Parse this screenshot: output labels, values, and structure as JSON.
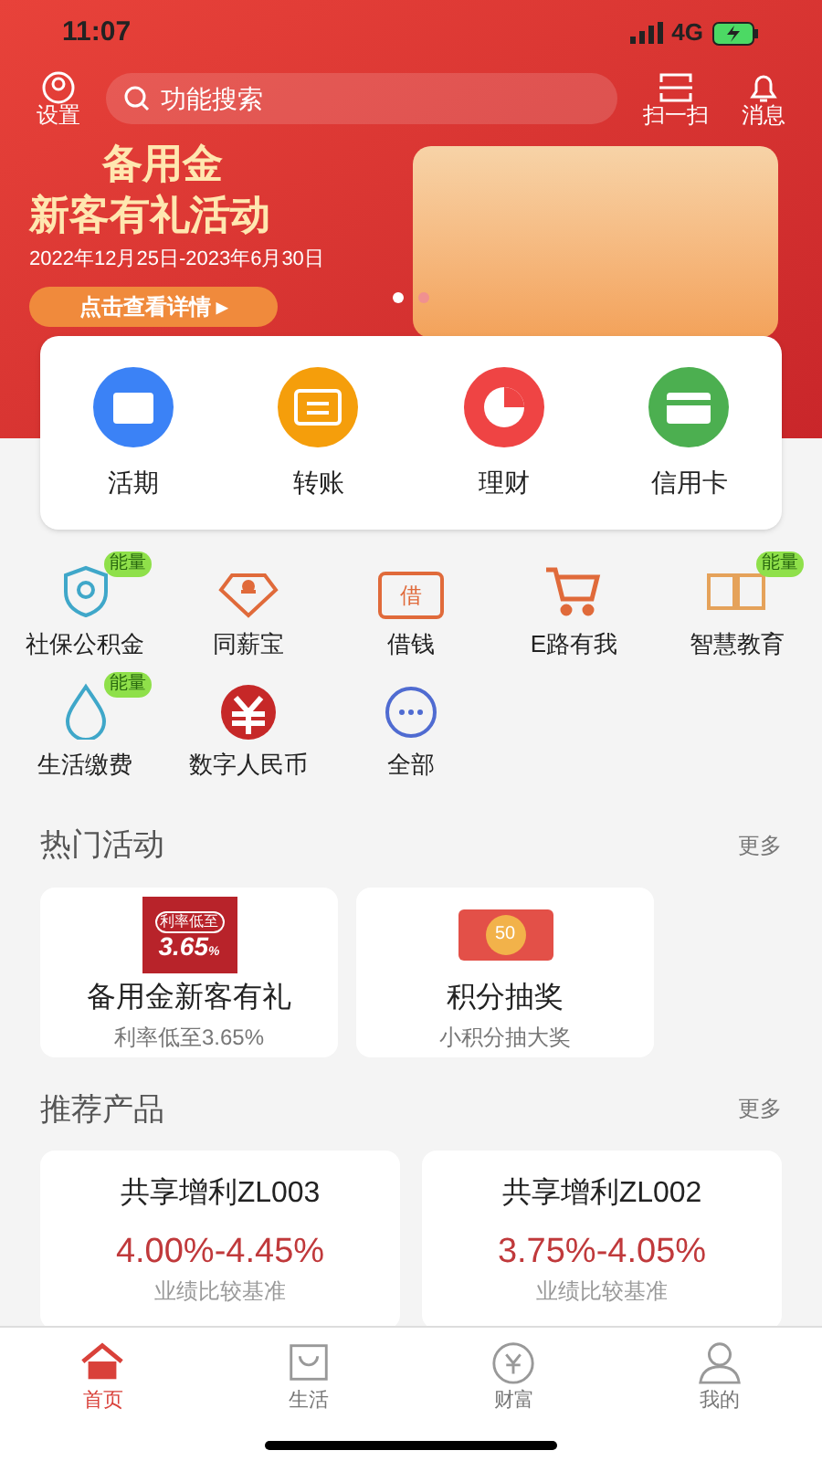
{
  "status_bar": {
    "time": "11:07",
    "network": "4G"
  },
  "header": {
    "settings_label": "设置",
    "search_placeholder": "功能搜索",
    "scan_label": "扫一扫",
    "messages_label": "消息"
  },
  "banner": {
    "title": "备用金",
    "subtitle": "新客有礼活动",
    "dates": "2022年12月25日-2023年6月30日",
    "button": "点击查看详情 ▸",
    "dots": [
      {
        "selected": true
      },
      {
        "selected": false
      }
    ]
  },
  "quick_actions": [
    {
      "label": "活期",
      "kind": "folder",
      "color": "#3b82f6"
    },
    {
      "label": "转账",
      "kind": "transfer",
      "color": "#f59e0b"
    },
    {
      "label": "理财",
      "kind": "pie",
      "color": "#ef4444"
    },
    {
      "label": "信用卡",
      "kind": "card",
      "color": "#4caf50"
    }
  ],
  "services": [
    {
      "label": "社保公积金",
      "kind": "shield",
      "badge": "能量"
    },
    {
      "label": "同薪宝",
      "kind": "diamond"
    },
    {
      "label": "借钱",
      "kind": "borrow",
      "icon_text": "借"
    },
    {
      "label": "E路有我",
      "kind": "cart"
    },
    {
      "label": "智慧教育",
      "kind": "book",
      "badge": "能量"
    },
    {
      "label": "生活缴费",
      "kind": "drop",
      "badge": "能量"
    },
    {
      "label": "数字人民币",
      "kind": "yuan"
    },
    {
      "label": "全部",
      "kind": "more"
    }
  ],
  "hot_activities": {
    "title": "热门活动",
    "more": "更多",
    "items": [
      {
        "title": "备用金新客有礼",
        "subtitle": "利率低至3.65%",
        "kind": "rate",
        "tag": "利率低至",
        "rate": "3.65",
        "unit": "%"
      },
      {
        "title": "积分抽奖",
        "subtitle": "小积分抽大奖",
        "kind": "lottery",
        "coin": "50"
      }
    ]
  },
  "recommended": {
    "title": "推荐产品",
    "more": "更多",
    "items": [
      {
        "name": "共享增利ZL003",
        "rate": "4.00%-4.45%",
        "note": "业绩比较基准"
      },
      {
        "name": "共享增利ZL002",
        "rate": "3.75%-4.05%",
        "note": "业绩比较基准"
      }
    ]
  },
  "tab_bar": [
    {
      "label": "首页",
      "kind": "home",
      "selected": true
    },
    {
      "label": "生活",
      "kind": "bag",
      "selected": false
    },
    {
      "label": "财富",
      "kind": "coin",
      "selected": false
    },
    {
      "label": "我的",
      "kind": "person",
      "selected": false
    }
  ]
}
